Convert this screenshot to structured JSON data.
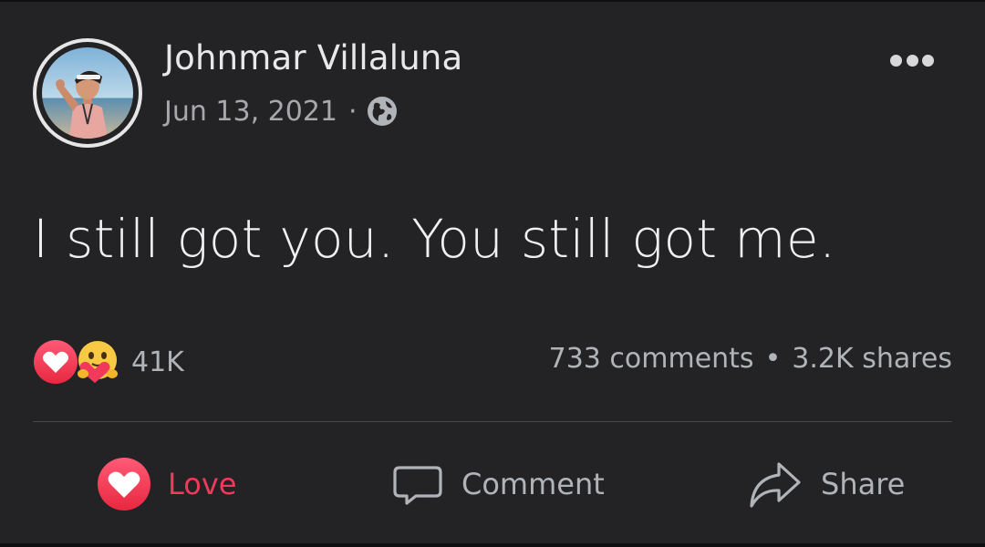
{
  "post": {
    "author_name": "Johnmar Villaluna",
    "date": "Jun 13, 2021",
    "separator": "·",
    "privacy_icon": "globe-icon",
    "more_icon": "more-options-icon",
    "text": "I still got you. You still got me."
  },
  "reactions": {
    "icons": [
      "love-reaction-icon",
      "care-reaction-icon"
    ],
    "count": "41K"
  },
  "stats": {
    "comments": "733 comments",
    "separator": "•",
    "shares": "3.2K shares"
  },
  "actions": {
    "love": {
      "label": "Love",
      "icon": "love-heart-icon"
    },
    "comment": {
      "label": "Comment",
      "icon": "comment-bubble-icon"
    },
    "share": {
      "label": "Share",
      "icon": "share-arrow-icon"
    }
  },
  "colors": {
    "background": "#232325",
    "text_primary": "#e8e8ea",
    "text_secondary": "#b0b3b8",
    "love_accent": "#f0395b",
    "care_yellow": "#f7c945"
  }
}
